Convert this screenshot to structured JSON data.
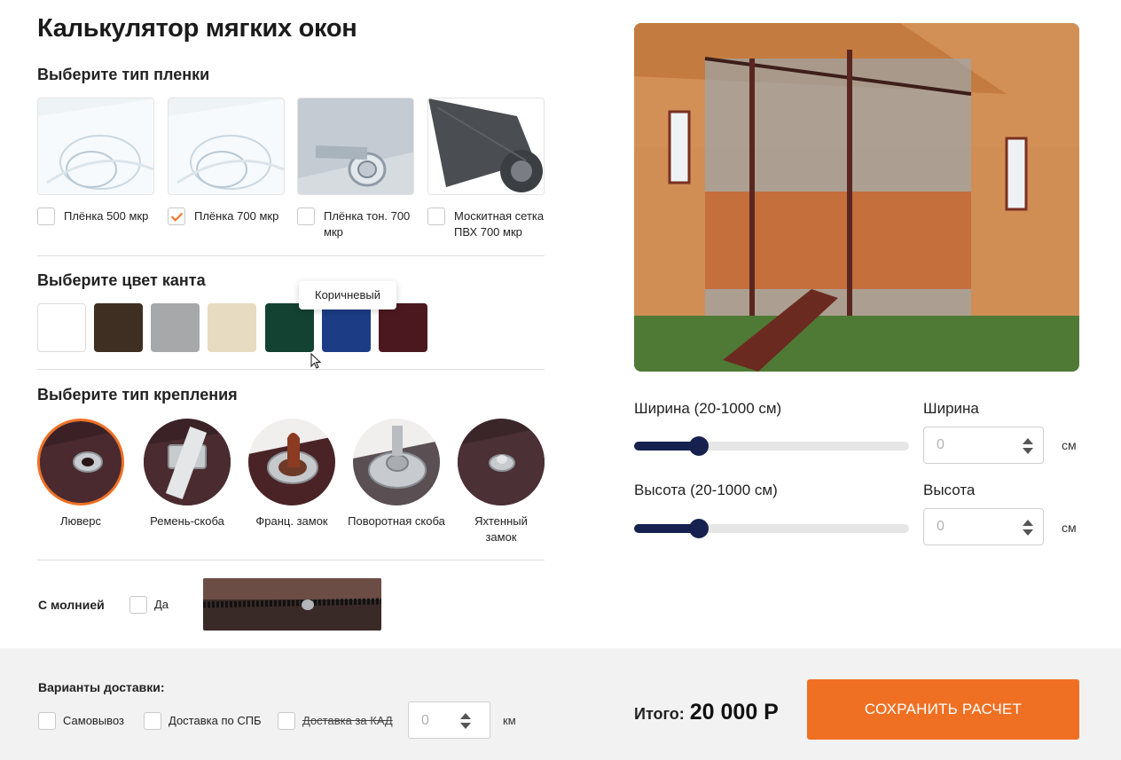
{
  "title": "Калькулятор мягких окон",
  "film": {
    "section_title": "Выберите тип пленки",
    "options": [
      {
        "label": "Плёнка 500 мкр",
        "checked": false
      },
      {
        "label": "Плёнка 700 мкр",
        "checked": true
      },
      {
        "label": "Плёнка тон. 700 мкр",
        "checked": false
      },
      {
        "label": "Москитная сетка ПВХ 700 мкр",
        "checked": false
      }
    ]
  },
  "edge_color": {
    "section_title": "Выберите цвет канта",
    "tooltip": "Коричневый",
    "swatches": [
      "#ffffff",
      "#3e2f22",
      "#a6a8aa",
      "#e7dbc1",
      "#134232",
      "#1c3d86",
      "#4c1820"
    ]
  },
  "mount": {
    "section_title": "Выберите тип крепления",
    "options": [
      {
        "label": "Люверс",
        "selected": true
      },
      {
        "label": "Ремень-скоба",
        "selected": false
      },
      {
        "label": "Франц. замок",
        "selected": false
      },
      {
        "label": "Поворотная скоба",
        "selected": false
      },
      {
        "label": "Яхтенный замок",
        "selected": false
      }
    ]
  },
  "zipper": {
    "label": "С молнией",
    "checkbox_label": "Да",
    "checked": false
  },
  "size": {
    "width": {
      "slider_label": "Ширина (20-1000 см)",
      "field_label": "Ширина",
      "placeholder": "0",
      "unit": "см",
      "slider_level": 0.2
    },
    "height": {
      "slider_label": "Высота (20-1000 см)",
      "field_label": "Высота",
      "placeholder": "0",
      "unit": "см",
      "slider_level": 0.2
    }
  },
  "delivery": {
    "title": "Варианты доставки:",
    "options": [
      {
        "label": "Самовывоз",
        "checked": false,
        "strikethrough": false
      },
      {
        "label": "Доставка по СПБ",
        "checked": false,
        "strikethrough": false
      },
      {
        "label": "Доставка за КАД",
        "checked": false,
        "strikethrough": true
      }
    ],
    "km_placeholder": "0",
    "km_unit": "км"
  },
  "total": {
    "label": "Итого:",
    "value": "20 000 Р"
  },
  "save_button": "СОХРАНИТЬ РАСЧЕТ",
  "colors": {
    "accent": "#f07023",
    "slider": "#16214f"
  }
}
